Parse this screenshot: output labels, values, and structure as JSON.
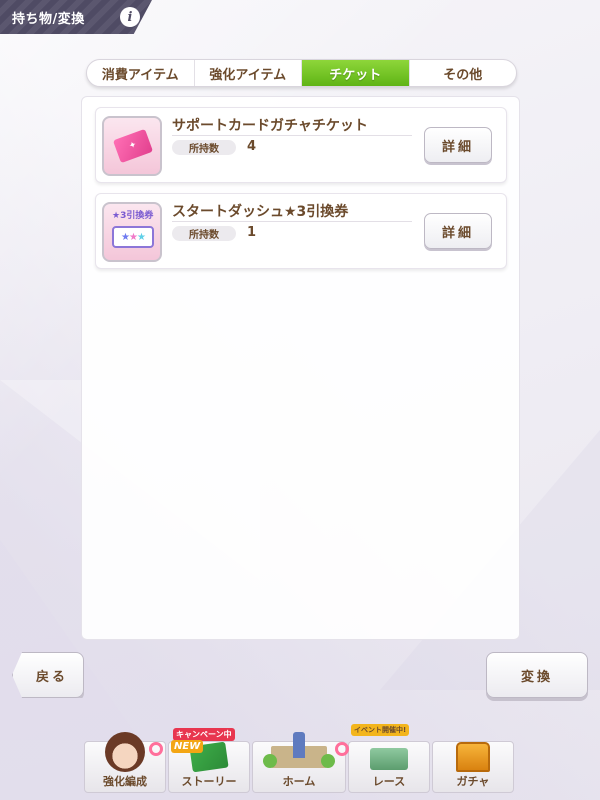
{
  "header": {
    "title": "持ち物/変換",
    "info_label": "i"
  },
  "tabs": [
    {
      "label": "消費アイテム",
      "active": false
    },
    {
      "label": "強化アイテム",
      "active": false
    },
    {
      "label": "チケット",
      "active": true
    },
    {
      "label": "その他",
      "active": false
    }
  ],
  "items": [
    {
      "name": "サポートカードガチャチケット",
      "qty_label": "所持数",
      "qty": "4",
      "detail_label": "詳細"
    },
    {
      "name": "スタートダッシュ★3引換券",
      "qty_label": "所持数",
      "qty": "1",
      "detail_label": "詳細",
      "icon_text": "★3引換券"
    }
  ],
  "buttons": {
    "back": "戻る",
    "exchange": "変換"
  },
  "nav": [
    {
      "label": "強化編成"
    },
    {
      "label": "ストーリー",
      "badge": "キャンペーン中",
      "new_badge": "NEW"
    },
    {
      "label": "ホーム"
    },
    {
      "label": "レース",
      "badge": "イベント開催中!"
    },
    {
      "label": "ガチャ"
    }
  ],
  "colors": {
    "accent_green": "#6cc11f",
    "text_brown": "#6b4a2c",
    "header_bg": "#4f4b64"
  }
}
